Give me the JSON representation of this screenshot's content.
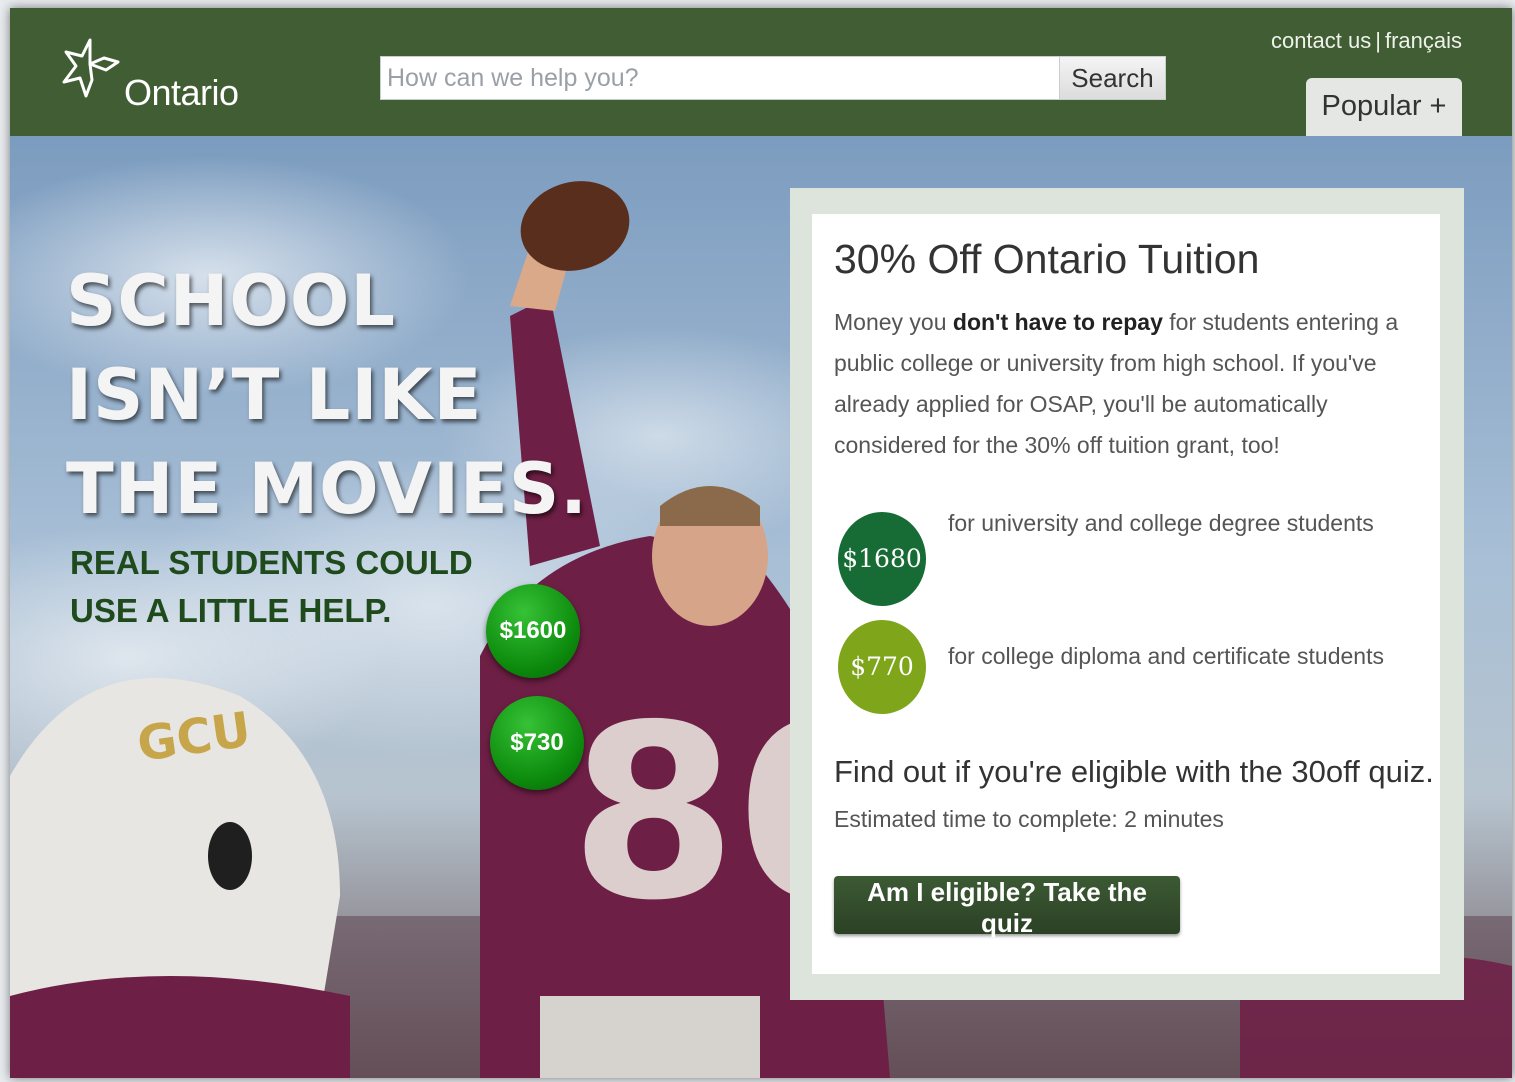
{
  "header": {
    "brand": "Ontario",
    "search": {
      "placeholder": "How can we help you?",
      "value": "",
      "button_label": "Search"
    },
    "links": {
      "contact": "contact us",
      "separator": "|",
      "french": "français"
    },
    "popular_tab": "Popular +"
  },
  "hero": {
    "headline": [
      "SCHOOL",
      "ISN’T LIKE",
      "THE MOVIES."
    ],
    "subline": [
      "REAL STUDENTS COULD",
      "USE A LITTLE HELP."
    ],
    "overlay_badges": [
      "$1600",
      "$730"
    ]
  },
  "card": {
    "title": "30% Off Ontario Tuition",
    "body_prefix": "Money you ",
    "body_bold": "don't have to repay",
    "body_suffix": " for students entering a public college or university from high school. If you've already applied for OSAP, you'll be automatically considered for the 30% off tuition grant, too!",
    "amounts": [
      {
        "value": "$1680",
        "description": "for university and college degree students"
      },
      {
        "value": "$770",
        "description": "for college diploma and certificate students"
      }
    ],
    "quiz_title": "Find out if you're eligible with the 30off quiz.",
    "quiz_time": "Estimated time to complete: 2 minutes",
    "quiz_button": "Am I eligible? Take the quiz"
  },
  "colors": {
    "header_green": "#415d33",
    "amount_dark_green": "#176b34",
    "amount_light_green": "#7fa61b",
    "badge_green": "#0c8a0c",
    "button_green": "#3c5a34"
  }
}
